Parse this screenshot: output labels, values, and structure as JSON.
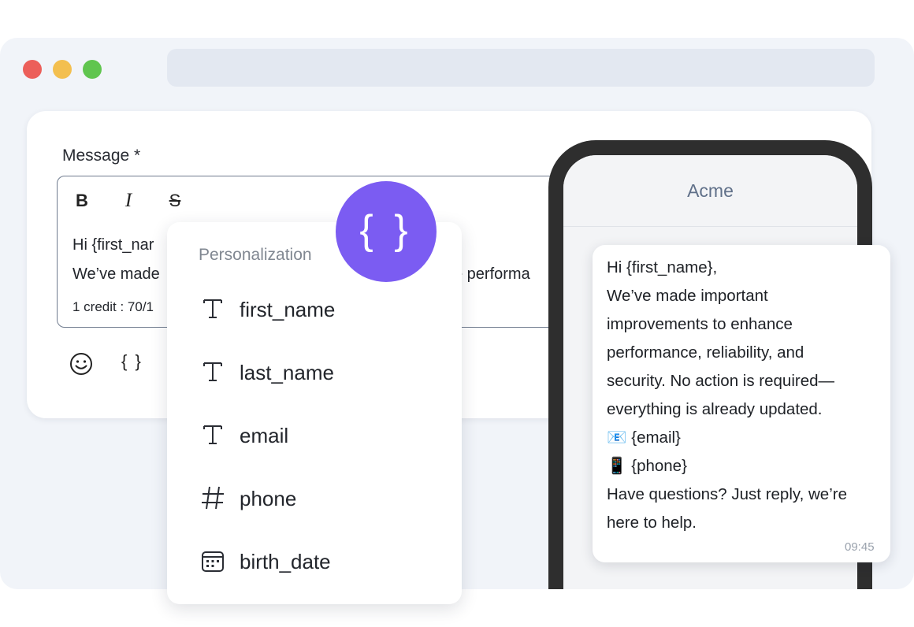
{
  "window": {
    "controls": [
      "close",
      "minimize",
      "maximize"
    ]
  },
  "editor": {
    "label": "Message *",
    "toolbar": {
      "bold": "B",
      "italic": "I",
      "strike": "S"
    },
    "line1": "Hi {first_nar",
    "line2": "We’ve made",
    "line2_tail": "ce performa",
    "credits": "1 credit : 70/1",
    "braces_button": "{ }"
  },
  "personalization": {
    "button_label": "{ }",
    "title": "Personalization",
    "items": [
      {
        "label": "first_name",
        "icon": "text-type-icon"
      },
      {
        "label": "last_name",
        "icon": "text-type-icon"
      },
      {
        "label": "email",
        "icon": "text-type-icon"
      },
      {
        "label": "phone",
        "icon": "hash-icon"
      },
      {
        "label": "birth_date",
        "icon": "calendar-icon"
      }
    ]
  },
  "preview": {
    "sender": "Acme",
    "message_lines": [
      "Hi {first_name},",
      "We’ve made important",
      "improvements to enhance",
      "performance, reliability, and",
      "security. No action is required—",
      "everything is already updated.",
      "📧 {email}",
      "📱 {phone}",
      "Have questions? Just reply, we’re",
      "here to help."
    ],
    "time": "09:45"
  },
  "colors": {
    "accent": "#7b5cf2",
    "window_bg": "#f1f4f9",
    "phone_frame": "#2e2e2e",
    "close": "#ec5f5a",
    "minimize": "#f3bf4f",
    "maximize": "#60c54f"
  }
}
